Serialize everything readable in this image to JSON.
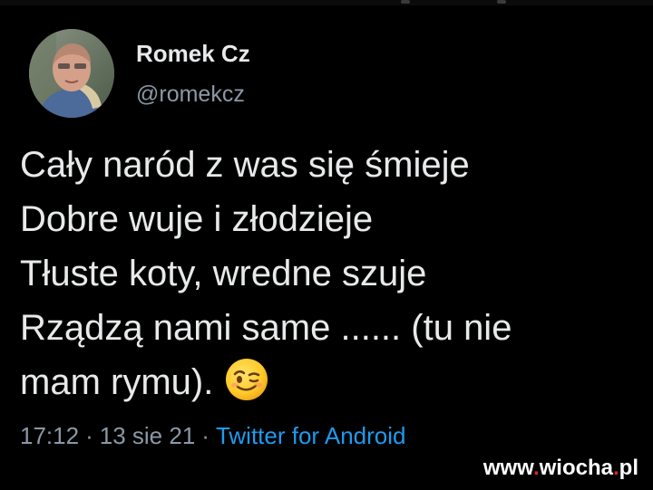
{
  "author": {
    "display_name": "Romek Cz",
    "handle": "@romekcz",
    "avatar_icon": "person-photo"
  },
  "tweet": {
    "lines": [
      "Cały naród z was się śmieje",
      "Dobre wuje i złodzieje",
      "Tłuste koty, wredne szuje",
      "Rządzą nami same ...... (tu nie",
      "mam rymu)."
    ],
    "emoji": "winking-face-with-tongue"
  },
  "meta": {
    "time": "17:12",
    "separator": "·",
    "date": "13 sie 21",
    "source": "Twitter for Android"
  },
  "watermark": {
    "prefix": "www",
    "dot1": ".",
    "name": "wiocha",
    "dot2": ".",
    "tld": "pl"
  },
  "colors": {
    "background": "#000000",
    "text": "#e7e9ea",
    "secondary": "#8b98a5",
    "link": "#1d9bf0"
  }
}
